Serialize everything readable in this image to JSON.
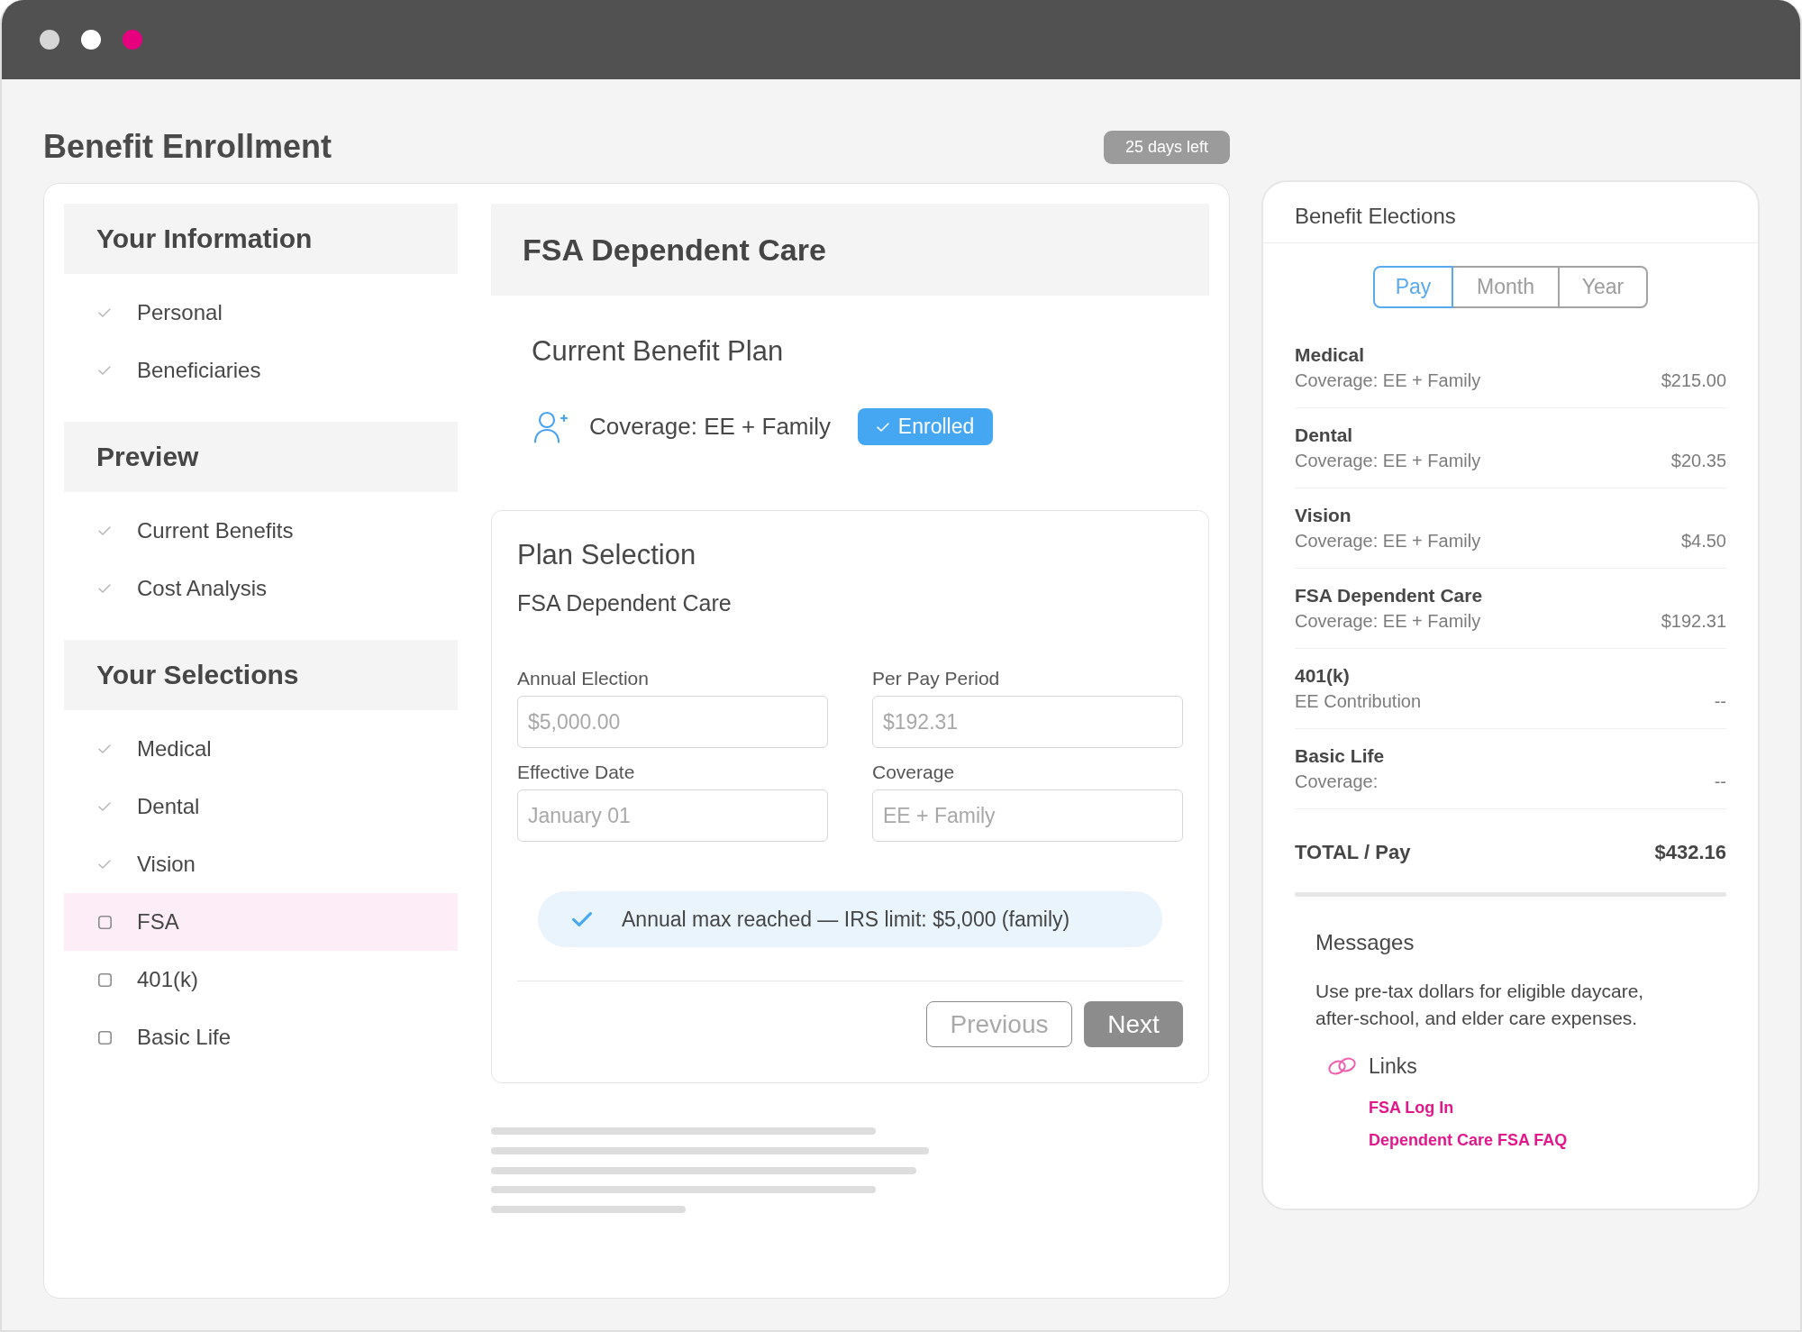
{
  "window": {
    "dots": [
      {
        "color": "#d6d6d6"
      },
      {
        "color": "#ffffff"
      },
      {
        "color": "#e6007e"
      }
    ]
  },
  "header": {
    "title": "Benefit Enrollment",
    "badge": "25 days left"
  },
  "sidebar": {
    "sections": [
      {
        "title": "Your Information",
        "items": [
          {
            "label": "Personal",
            "checked": true,
            "selected": false
          },
          {
            "label": "Beneficiaries",
            "checked": true,
            "selected": false
          }
        ]
      },
      {
        "title": "Preview",
        "items": [
          {
            "label": "Current Benefits",
            "checked": true,
            "selected": false
          },
          {
            "label": "Cost Analysis",
            "checked": true,
            "selected": false
          }
        ]
      },
      {
        "title": "Your Selections",
        "items": [
          {
            "label": "Medical",
            "checked": true,
            "selected": false
          },
          {
            "label": "Dental",
            "checked": true,
            "selected": false
          },
          {
            "label": "Vision",
            "checked": true,
            "selected": false
          },
          {
            "label": "FSA",
            "checked": false,
            "selected": true
          },
          {
            "label": "401(k)",
            "checked": false,
            "selected": false
          },
          {
            "label": "Basic Life",
            "checked": false,
            "selected": false
          }
        ]
      }
    ]
  },
  "main": {
    "title": "FSA Dependent Care",
    "current_plan": {
      "title": "Current Benefit Plan",
      "coverage": "Coverage: EE + Family",
      "status": "Enrolled"
    },
    "plan_selection": {
      "title": "Plan Selection",
      "plan": "FSA Dependent Care",
      "fields": [
        {
          "label": "Annual Election",
          "value": "$5,000.00",
          "disabled": true
        },
        {
          "label": "Per Pay Period",
          "value": "$192.31",
          "disabled": true
        },
        {
          "label": "Effective Date",
          "value": "January 01",
          "disabled": true
        },
        {
          "label": "Coverage",
          "value": "EE + Family",
          "disabled": true
        }
      ],
      "alert": "Annual max reached — IRS limit: $5,000 (family)",
      "buttons": [
        {
          "label": "Previous",
          "kind": "back"
        },
        {
          "label": "Next",
          "kind": "next"
        }
      ]
    }
  },
  "elections": {
    "title": "Benefit Elections",
    "periods": [
      {
        "label": "Pay",
        "selected": true
      },
      {
        "label": "Month",
        "selected": false
      },
      {
        "label": "Year",
        "selected": false
      }
    ],
    "rows": [
      {
        "name": "Medical",
        "detail": "Coverage: EE + Family",
        "amount": "$215.00"
      },
      {
        "name": "Dental",
        "detail": "Coverage: EE + Family",
        "amount": "$20.35"
      },
      {
        "name": "Vision",
        "detail": "Coverage: EE + Family",
        "amount": "$4.50"
      },
      {
        "name": "FSA Dependent Care",
        "detail": "Coverage: EE + Family",
        "amount": "$192.31"
      },
      {
        "name": "401(k)",
        "detail": "EE Contribution",
        "amount": "--"
      },
      {
        "name": "Basic Life",
        "detail": "Coverage:",
        "amount": "--"
      }
    ],
    "total": {
      "label": "TOTAL / Pay",
      "amount": "$432.16"
    },
    "messages": {
      "title": "Messages",
      "text": "Use pre-tax dollars for eligible daycare, after-school, and elder care expenses.",
      "links_title": "Links",
      "links": [
        {
          "label": "FSA Log In"
        },
        {
          "label": "Dependent Care FSA FAQ"
        }
      ]
    }
  }
}
